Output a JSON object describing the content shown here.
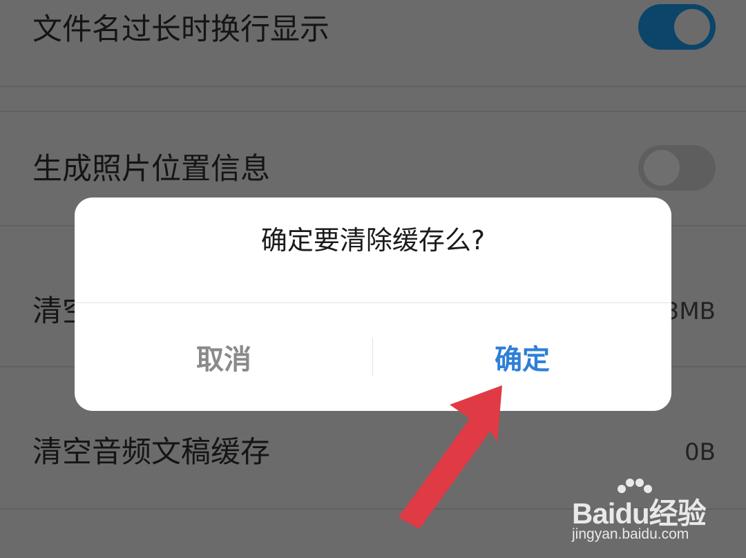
{
  "settings": {
    "rows": [
      {
        "label": "文件名过长时换行显示",
        "toggle": "on"
      },
      {
        "label": "生成照片位置信息",
        "toggle": "off"
      },
      {
        "label": "清空",
        "value": "3MB"
      },
      {
        "label": "清空音频文稿缓存",
        "value": "0B"
      }
    ]
  },
  "dialog": {
    "title": "确定要清除缓存么?",
    "cancel_label": "取消",
    "confirm_label": "确定"
  },
  "watermark": {
    "brand_prefix": "Bai",
    "brand_du": "du",
    "brand_suffix": "经验",
    "url": "jingyan.baidu.com"
  },
  "colors": {
    "overlay_bg": "#6b6b6b",
    "toggle_on": "#0b4569",
    "confirm_text": "#2e7fd6",
    "cancel_text": "#8a8a8a",
    "arrow": "#e03a45"
  },
  "icons": {
    "arrow": "red-arrow-annotation",
    "watermark_paw": "baidu-paw-icon"
  }
}
